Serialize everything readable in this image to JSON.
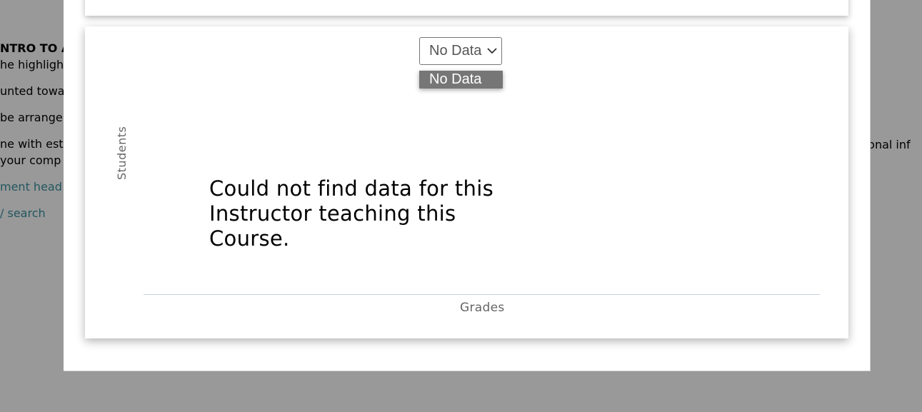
{
  "background": {
    "lines": [
      {
        "text": "NTRO TO A",
        "style": "bold"
      },
      {
        "text": "he highligh",
        "style": "normal"
      },
      {
        "text": "unted towa",
        "style": "normal"
      },
      {
        "text": "be arrange",
        "style": "normal"
      },
      {
        "text": "ne with est",
        "style": "normal"
      },
      {
        "text": " your comp",
        "style": "normal"
      },
      {
        "text": "ment head",
        "style": "link"
      },
      {
        "text": "/ search",
        "style": "link"
      }
    ],
    "right_text": "itional inf"
  },
  "chart": {
    "selector": {
      "selected": "No Data",
      "options": [
        "No Data"
      ]
    },
    "ylabel": "Students",
    "xlabel": "Grades",
    "message": "Could not find data for this Instructor teaching this Course."
  },
  "colors": {
    "overlay": "#999999",
    "dropdown_highlight": "#767676",
    "axis_line": "#c7d2dd",
    "link": "#23565f"
  },
  "chart_data": {
    "type": "bar",
    "title": "",
    "xlabel": "Grades",
    "ylabel": "Students",
    "categories": [],
    "values": []
  }
}
